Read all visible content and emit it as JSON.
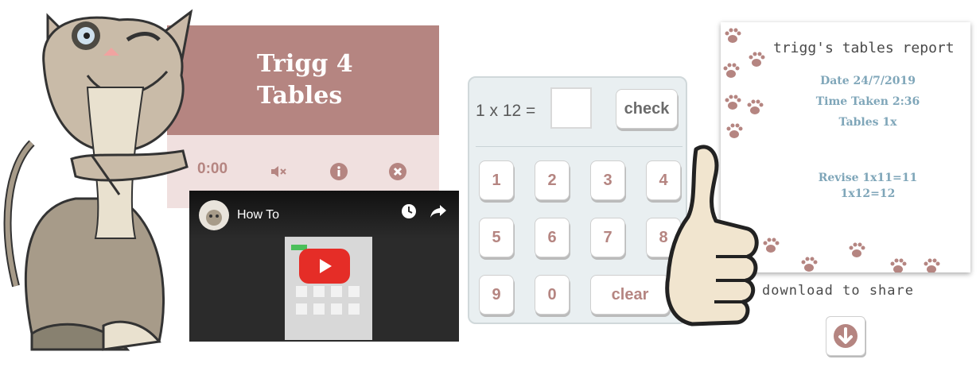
{
  "app": {
    "title_line1": "Trigg 4",
    "title_line2": "Tables",
    "timer": "0:00",
    "colors": {
      "brand": "#b58581",
      "panel": "#f0e0df"
    },
    "icons": [
      "mute-icon",
      "info-icon",
      "close-icon"
    ]
  },
  "video": {
    "title": "How To",
    "icons": [
      "clock-icon",
      "share-icon",
      "play-icon"
    ]
  },
  "keypad": {
    "question": "1 x 12 =",
    "answer_value": "",
    "check_label": "check",
    "keys": [
      "1",
      "2",
      "3",
      "4",
      "5",
      "6",
      "7",
      "8",
      "9",
      "0"
    ],
    "clear_label": "clear"
  },
  "report": {
    "title": "trigg's tables report",
    "date": "Date 24/7/2019",
    "time_taken": "Time Taken 2:36",
    "tables": "Tables 1x",
    "revise_line1": "Revise 1x11=11",
    "revise_line2": "1x12=12"
  },
  "download": {
    "caption": "download to share",
    "icon": "download-icon"
  }
}
